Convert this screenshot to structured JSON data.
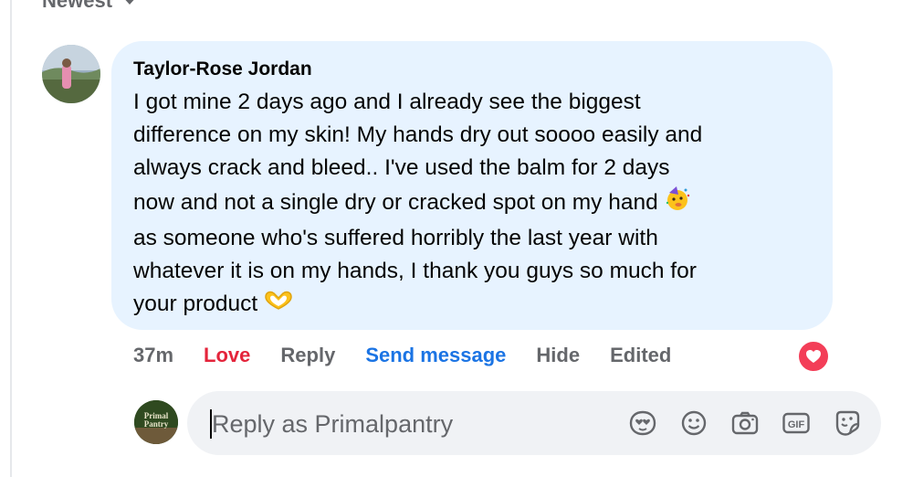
{
  "sort": {
    "label": "Newest",
    "icon": "chevron-down-icon"
  },
  "comment": {
    "author": "Taylor-Rose Jordan",
    "avatar_icon": "profile-photo",
    "lines": [
      "I got mine 2 days ago and I already see the biggest",
      "difference on my skin! My hands dry out soooo easily and",
      "always crack and bleed.. I've used the balm for 2 days",
      "now and not a single dry or cracked spot on my hand",
      "as someone who's suffered horribly the last year with",
      "whatever it is on my hands, I thank you guys so much for",
      "your product"
    ],
    "emojis": [
      "partying-face-emoji",
      "heart-hands-emoji"
    ]
  },
  "actions": {
    "time": "37m",
    "love": "Love",
    "reply": "Reply",
    "send_message": "Send message",
    "hide": "Hide",
    "edited": "Edited",
    "reaction_icon": "heart-reaction-icon"
  },
  "reply": {
    "avatar_text": "Primal Pantry",
    "placeholder": "Reply as Primalpantry",
    "value": "",
    "tools": [
      "avatar-sticker-icon",
      "emoji-icon",
      "camera-icon",
      "gif-icon",
      "sticker-icon"
    ]
  },
  "colors": {
    "bubble": "#e7f3ff",
    "love": "#e4243b",
    "link": "#1b74e4",
    "muted": "#65676b",
    "reaction": "#f33e58"
  }
}
